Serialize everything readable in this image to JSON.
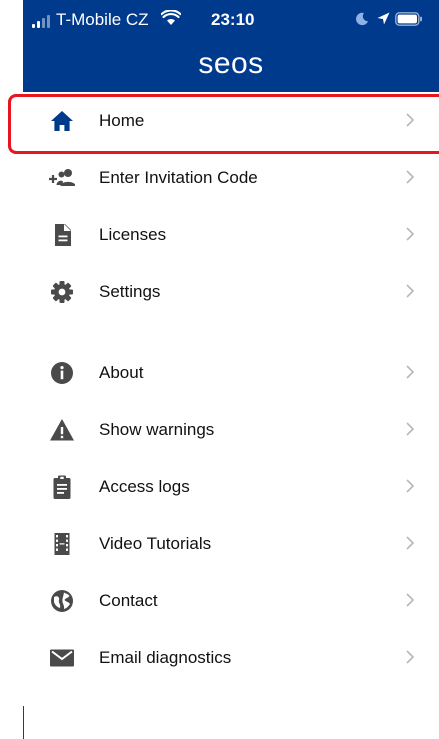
{
  "status_bar": {
    "carrier": "T-Mobile CZ",
    "time": "23:10",
    "signal_icon": "cellular-signal-icon",
    "wifi_icon": "wifi-icon",
    "moon_icon": "do-not-disturb-icon",
    "location_icon": "location-arrow-icon",
    "battery_icon": "battery-icon"
  },
  "header": {
    "brand": "seos",
    "background_color": "#003a8c"
  },
  "menu": {
    "items": [
      {
        "label": "Home",
        "icon": "home-icon",
        "selected": true
      },
      {
        "label": "Enter Invitation Code",
        "icon": "add-people-icon"
      },
      {
        "label": "Licenses",
        "icon": "document-icon"
      },
      {
        "label": "Settings",
        "icon": "gear-icon"
      },
      {
        "label": "About",
        "icon": "info-icon"
      },
      {
        "label": "Show warnings",
        "icon": "warning-icon"
      },
      {
        "label": "Access logs",
        "icon": "clipboard-icon"
      },
      {
        "label": "Video Tutorials",
        "icon": "film-icon"
      },
      {
        "label": "Contact",
        "icon": "globe-icon"
      },
      {
        "label": "Email diagnostics",
        "icon": "envelope-icon"
      }
    ]
  },
  "colors": {
    "highlight_border": "#e8141f",
    "icon_gray": "#4a4a4a",
    "active_icon": "#003a8c",
    "chevron": "#b8b8b8"
  }
}
